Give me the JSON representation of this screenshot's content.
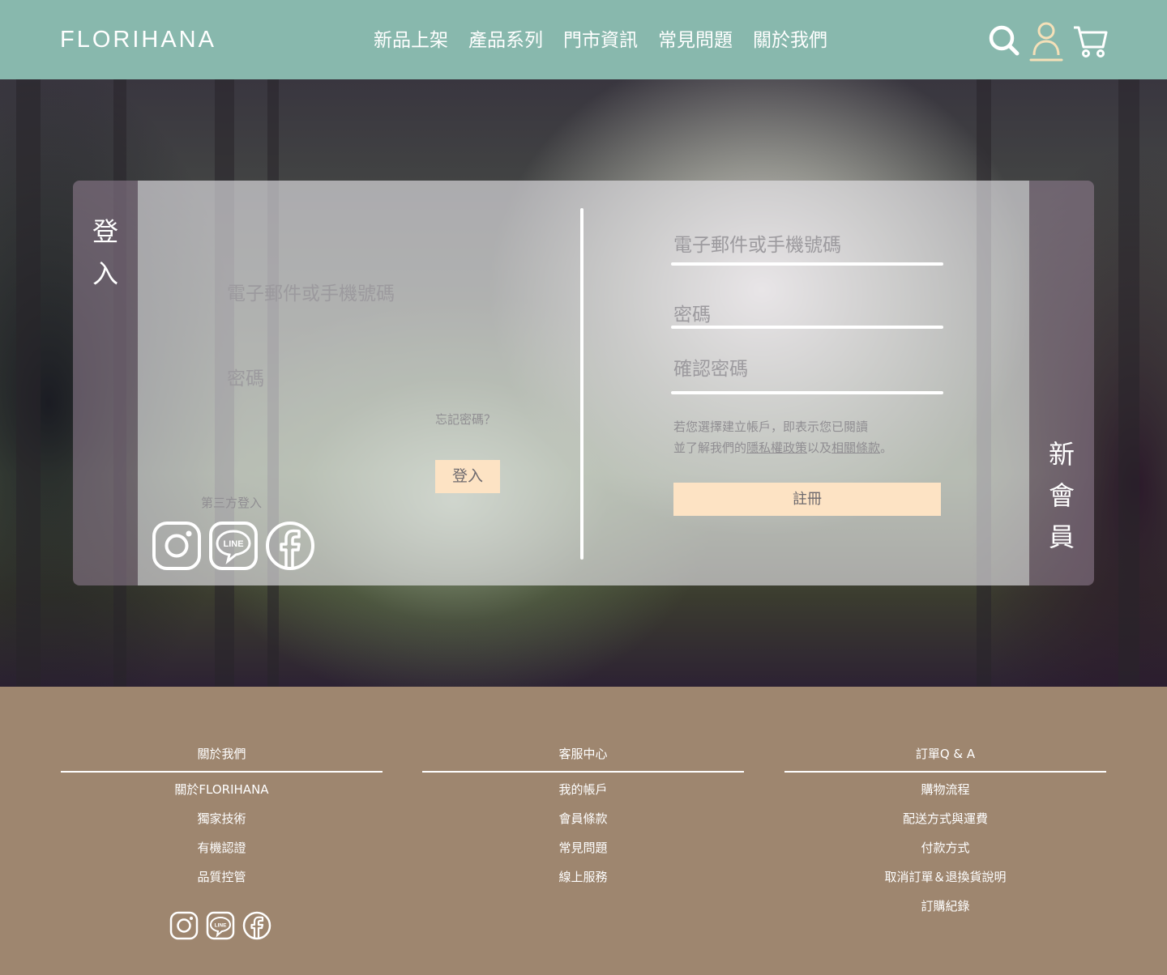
{
  "header": {
    "logo": "FLORIHANA",
    "nav": [
      {
        "label": "新品上架"
      },
      {
        "label": "產品系列"
      },
      {
        "label": "門市資訊"
      },
      {
        "label": "常見問題"
      },
      {
        "label": "關於我們"
      }
    ],
    "icons": [
      "search-icon",
      "user-icon",
      "cart-icon"
    ],
    "colors": {
      "bg": "#88b8ad",
      "user_accent": "#f5e0b8"
    }
  },
  "login": {
    "tab_chars": [
      "登",
      "入"
    ],
    "email_placeholder": "電子郵件或手機號碼",
    "password_placeholder": "密碼",
    "forgot": "忘記密碼？",
    "submit": "登入",
    "third_party": "第三方登入",
    "social": [
      "instagram-icon",
      "line-icon",
      "facebook-icon"
    ]
  },
  "register": {
    "tab_chars": [
      "新",
      "會",
      "員"
    ],
    "email_placeholder": "電子郵件或手機號碼",
    "password_placeholder": "密碼",
    "confirm_placeholder": "確認密碼",
    "terms_line1": "若您選擇建立帳戶，即表示您已閱讀",
    "terms_line2_prefix": "並了解我們的",
    "privacy_link": "隱私權政策",
    "terms_mid": "以及",
    "terms_link": "相關條款",
    "terms_end": "。",
    "submit": "註冊",
    "button_color": "#fde3c4"
  },
  "footer": {
    "columns": [
      {
        "title": "關於我們",
        "items": [
          "關於FLORIHANA",
          "獨家技術",
          "有機認證",
          "品質控管"
        ]
      },
      {
        "title": "客服中心",
        "items": [
          "我的帳戶",
          "會員條款",
          "常見問題",
          "線上服務"
        ]
      },
      {
        "title": "訂單Q & A",
        "items": [
          "購物流程",
          "配送方式與運費",
          "付款方式",
          "取消訂單＆退換貨說明",
          "訂購紀錄"
        ]
      }
    ],
    "social": [
      "instagram-icon",
      "line-icon",
      "facebook-icon"
    ],
    "bg": "#9e866f"
  }
}
